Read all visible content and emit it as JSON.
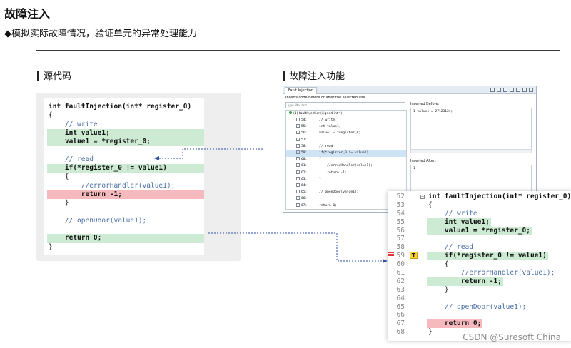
{
  "title": "故障注入",
  "subtitle": "◆模拟实际故障情况，验证单元的异常处理能力",
  "left_heading": "源代码",
  "right_heading": "故障注入功能",
  "source_code": [
    {
      "text": "int faultInjection(int* register_0)",
      "style": "bold"
    },
    {
      "text": "{",
      "style": ""
    },
    {
      "text": "    // write",
      "style": "comment"
    },
    {
      "text": "    int value1;",
      "style": "green-bold"
    },
    {
      "text": "    value1 = *register_0;",
      "style": "green-bold"
    },
    {
      "text": "",
      "style": ""
    },
    {
      "text": "    // read",
      "style": "comment"
    },
    {
      "text": "    if(*register_0 != value1)",
      "style": "green-bold"
    },
    {
      "text": "    {",
      "style": ""
    },
    {
      "text": "        //errorHandler(value1);",
      "style": "comment"
    },
    {
      "text": "        return -1;",
      "style": "red-bold"
    },
    {
      "text": "    }",
      "style": ""
    },
    {
      "text": "",
      "style": ""
    },
    {
      "text": "    // openDoor(value1);",
      "style": "comment"
    },
    {
      "text": "",
      "style": ""
    },
    {
      "text": "    return 0;",
      "style": "green-bold"
    },
    {
      "text": "}",
      "style": ""
    }
  ],
  "panel": {
    "tab_label": "Fault Injection",
    "description": "Inserts code before or after the selected line.",
    "filter_placeholder": "type filter text",
    "tree_root": "(1) faultInjection(signed int *)",
    "rows": [
      {
        "ln": "54:",
        "code": "    // write",
        "checked": false,
        "selected": false
      },
      {
        "ln": "55:",
        "code": "    int value1;",
        "checked": false,
        "selected": false
      },
      {
        "ln": "56:",
        "code": "    value1 = *register_0;",
        "checked": false,
        "selected": false
      },
      {
        "ln": "57:",
        "code": "",
        "checked": false,
        "selected": false
      },
      {
        "ln": "58:",
        "code": "    // read",
        "checked": false,
        "selected": false
      },
      {
        "ln": "59:",
        "code": "    if(*register_0 != value1)",
        "checked": true,
        "selected": true
      },
      {
        "ln": "60:",
        "code": "    {",
        "checked": false,
        "selected": false
      },
      {
        "ln": "61:",
        "code": "        //errorHandler(value1);",
        "checked": false,
        "selected": false
      },
      {
        "ln": "62:",
        "code": "        return -1;",
        "checked": false,
        "selected": false
      },
      {
        "ln": "63:",
        "code": "    }",
        "checked": false,
        "selected": false
      },
      {
        "ln": "64:",
        "code": "",
        "checked": false,
        "selected": false
      },
      {
        "ln": "65:",
        "code": "    // openDoor(value1);",
        "checked": false,
        "selected": false
      },
      {
        "ln": "66:",
        "code": "",
        "checked": false,
        "selected": false
      },
      {
        "ln": "67:",
        "code": "    return 0;",
        "checked": false,
        "selected": false
      }
    ],
    "inserted_before_label": "Inserted Before:",
    "inserted_before_value": "1 value1 = 27123124;",
    "inserted_after_label": "Inserted After:",
    "inserted_after_value": "1"
  },
  "zoom_code": [
    {
      "ln": "52",
      "text": "int faultInjection(int* register_0)",
      "style": "bold"
    },
    {
      "ln": "53",
      "text": "{",
      "style": ""
    },
    {
      "ln": "54",
      "text": "    // write",
      "style": "comment"
    },
    {
      "ln": "55",
      "text": "    int value1;",
      "style": "green-bold"
    },
    {
      "ln": "56",
      "text": "    value1 = *register_0;",
      "style": "green-bold"
    },
    {
      "ln": "57",
      "text": "",
      "style": ""
    },
    {
      "ln": "58",
      "text": "    // read",
      "style": "comment"
    },
    {
      "ln": "59",
      "text": "    if(*register_0 != value1)",
      "style": "green-bold"
    },
    {
      "ln": "60",
      "text": "    {",
      "style": ""
    },
    {
      "ln": "61",
      "text": "        //errorHandler(value1);",
      "style": "comment"
    },
    {
      "ln": "62",
      "text": "        return -1;",
      "style": "green-bold"
    },
    {
      "ln": "63",
      "text": "    }",
      "style": ""
    },
    {
      "ln": "64",
      "text": "",
      "style": ""
    },
    {
      "ln": "65",
      "text": "    // openDoor(value1);",
      "style": "comment"
    },
    {
      "ln": "66",
      "text": "",
      "style": ""
    },
    {
      "ln": "67",
      "text": "    return 0;",
      "style": "red-bold"
    },
    {
      "ln": "68",
      "text": "}",
      "style": ""
    }
  ],
  "zoom_marker": "T",
  "watermark": "CSDN @Suresoft China",
  "colors": {
    "green_highlight": "#cdebd3",
    "red_highlight": "#f6b9bd",
    "selection": "#cfe3f7",
    "connector": "#2f4fa8"
  }
}
